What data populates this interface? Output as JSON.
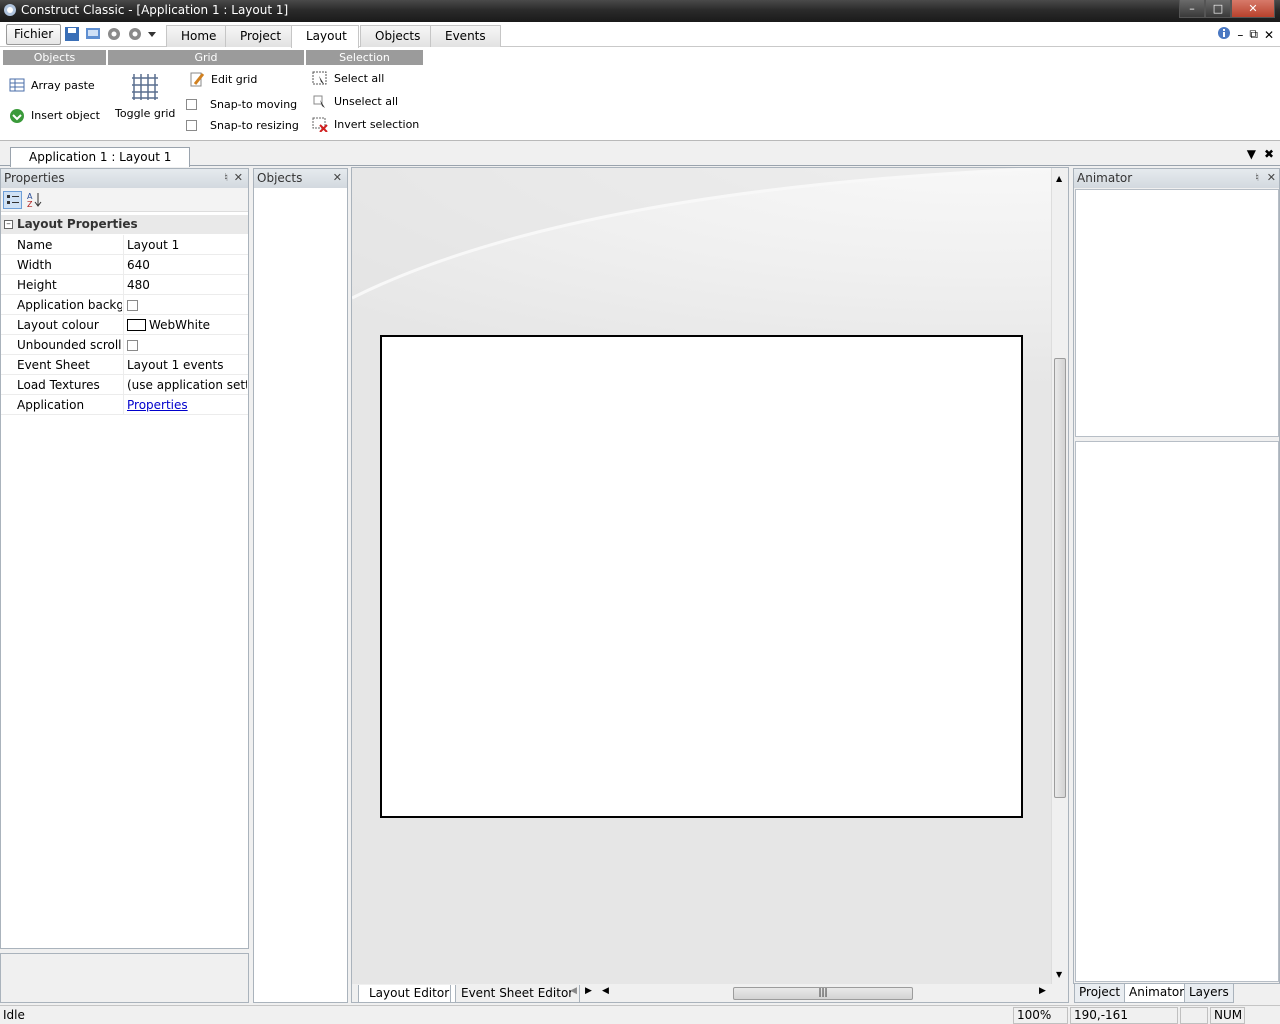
{
  "window": {
    "title": "Construct Classic - [Application 1 : Layout 1]"
  },
  "menu": {
    "fichier": "Fichier"
  },
  "ribbon_tabs": [
    "Home",
    "Project",
    "Layout",
    "Objects",
    "Events"
  ],
  "active_ribbon_tab": "Layout",
  "ribbon": {
    "groups": {
      "objects": "Objects",
      "grid": "Grid",
      "selection": "Selection"
    },
    "array_paste": "Array paste",
    "insert_object": "Insert object",
    "toggle_grid": "Toggle grid",
    "edit_grid": "Edit grid",
    "snap_moving": "Snap-to moving",
    "snap_resizing": "Snap-to resizing",
    "select_all": "Select all",
    "unselect_all": "Unselect all",
    "invert_selection": "Invert selection"
  },
  "document_tab": "Application 1 : Layout 1",
  "properties_panel": {
    "title": "Properties",
    "category": "Layout Properties",
    "rows": [
      {
        "key": "Name",
        "value": "Layout 1"
      },
      {
        "key": "Width",
        "value": "640"
      },
      {
        "key": "Height",
        "value": "480"
      },
      {
        "key": "Application background",
        "checkbox": true,
        "checked": false
      },
      {
        "key": "Layout colour",
        "value": "WebWhite",
        "swatch": "#ffffff"
      },
      {
        "key": "Unbounded scrolling",
        "checkbox": true,
        "checked": false
      },
      {
        "key": "Event Sheet",
        "value": "Layout 1 events"
      },
      {
        "key": "Load Textures",
        "value": "(use application setting)"
      },
      {
        "key": "Application",
        "value": "Properties",
        "link": true
      }
    ]
  },
  "objects_panel": {
    "title": "Objects"
  },
  "animator_panel": {
    "title": "Animator"
  },
  "editor_tabs": [
    "Layout Editor",
    "Event Sheet Editor"
  ],
  "right_tabs": [
    "Project",
    "Animator",
    "Layers"
  ],
  "active_right_tab": "Animator",
  "status": {
    "text": "Idle",
    "zoom": "100%",
    "coords": "190,-161",
    "num": "NUM"
  },
  "colors": {
    "group_header": "#9b9b9b",
    "panel_header": "#d3d9df",
    "link": "#0000cc"
  }
}
